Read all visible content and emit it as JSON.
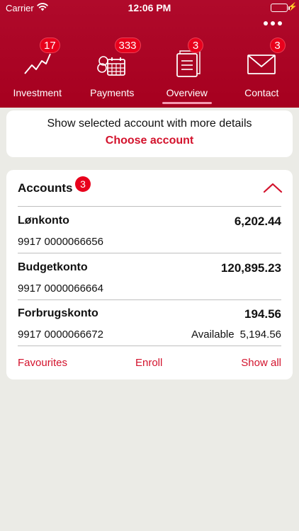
{
  "status_bar": {
    "carrier": "Carrier",
    "time": "12:06 PM"
  },
  "colors": {
    "brand_red": "#a6001f",
    "badge_red": "#e8001c",
    "link_red": "#d3122c",
    "background": "#ebebe6"
  },
  "tabs": [
    {
      "label": "Investment",
      "icon": "chart-line-icon",
      "badge": "17"
    },
    {
      "label": "Payments",
      "icon": "calendar-icon",
      "badge": "333"
    },
    {
      "label": "Overview",
      "icon": "documents-icon",
      "badge": "3",
      "active": true
    },
    {
      "label": "Contact",
      "icon": "envelope-icon",
      "badge": "3"
    }
  ],
  "choose_card": {
    "hint": "Show selected account with more details",
    "action": "Choose account"
  },
  "accounts": {
    "title": "Accounts",
    "badge": "3",
    "items": [
      {
        "name": "Lønkonto",
        "balance": "6,202.44",
        "number": "9917 0000066656"
      },
      {
        "name": "Budgetkonto",
        "balance": "120,895.23",
        "number": "9917 0000066664"
      },
      {
        "name": "Forbrugskonto",
        "balance": "194.56",
        "number": "9917 0000066672",
        "available_label": "Available",
        "available_value": "5,194.56"
      }
    ],
    "footer": {
      "favourites": "Favourites",
      "enroll": "Enroll",
      "show_all": "Show all"
    }
  }
}
